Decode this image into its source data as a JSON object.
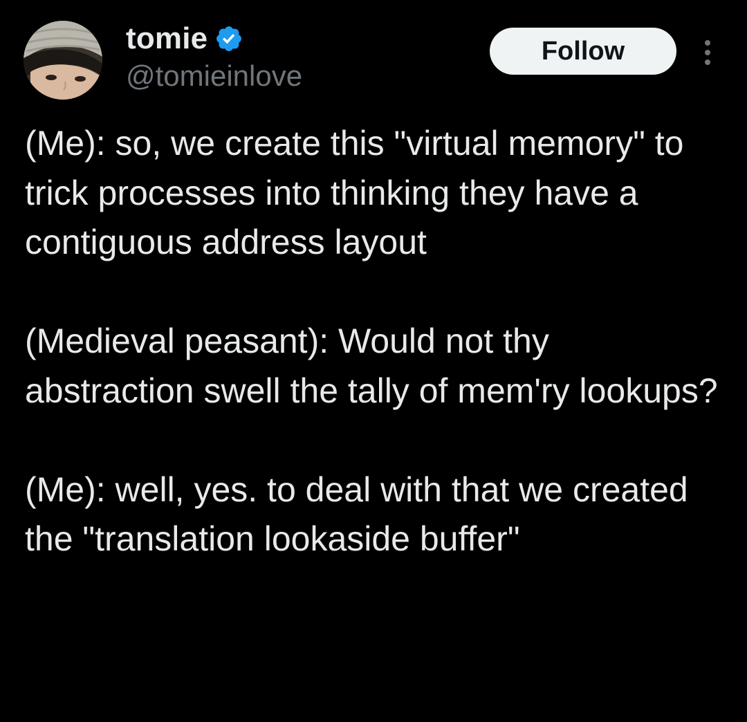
{
  "user": {
    "display_name": "tomie",
    "handle": "@tomieinlove",
    "verified": true,
    "verified_color": "#1d9bf0"
  },
  "actions": {
    "follow_label": "Follow",
    "more_icon": "more-vertical-icon"
  },
  "tweet": {
    "paragraphs": [
      "(Me): so, we create this \"virtual memory\" to trick processes into thinking they have a contiguous address layout",
      "(Medieval peasant): Would not thy abstraction swell the tally of mem'ry lookups?",
      "(Me): well, yes. to deal with that we created the \"translation lookaside buffer\""
    ]
  },
  "colors": {
    "background": "#000000",
    "text": "#e7e9ea",
    "secondary_text": "#71767b",
    "button_bg": "#eff3f4",
    "button_text": "#0f1419"
  }
}
